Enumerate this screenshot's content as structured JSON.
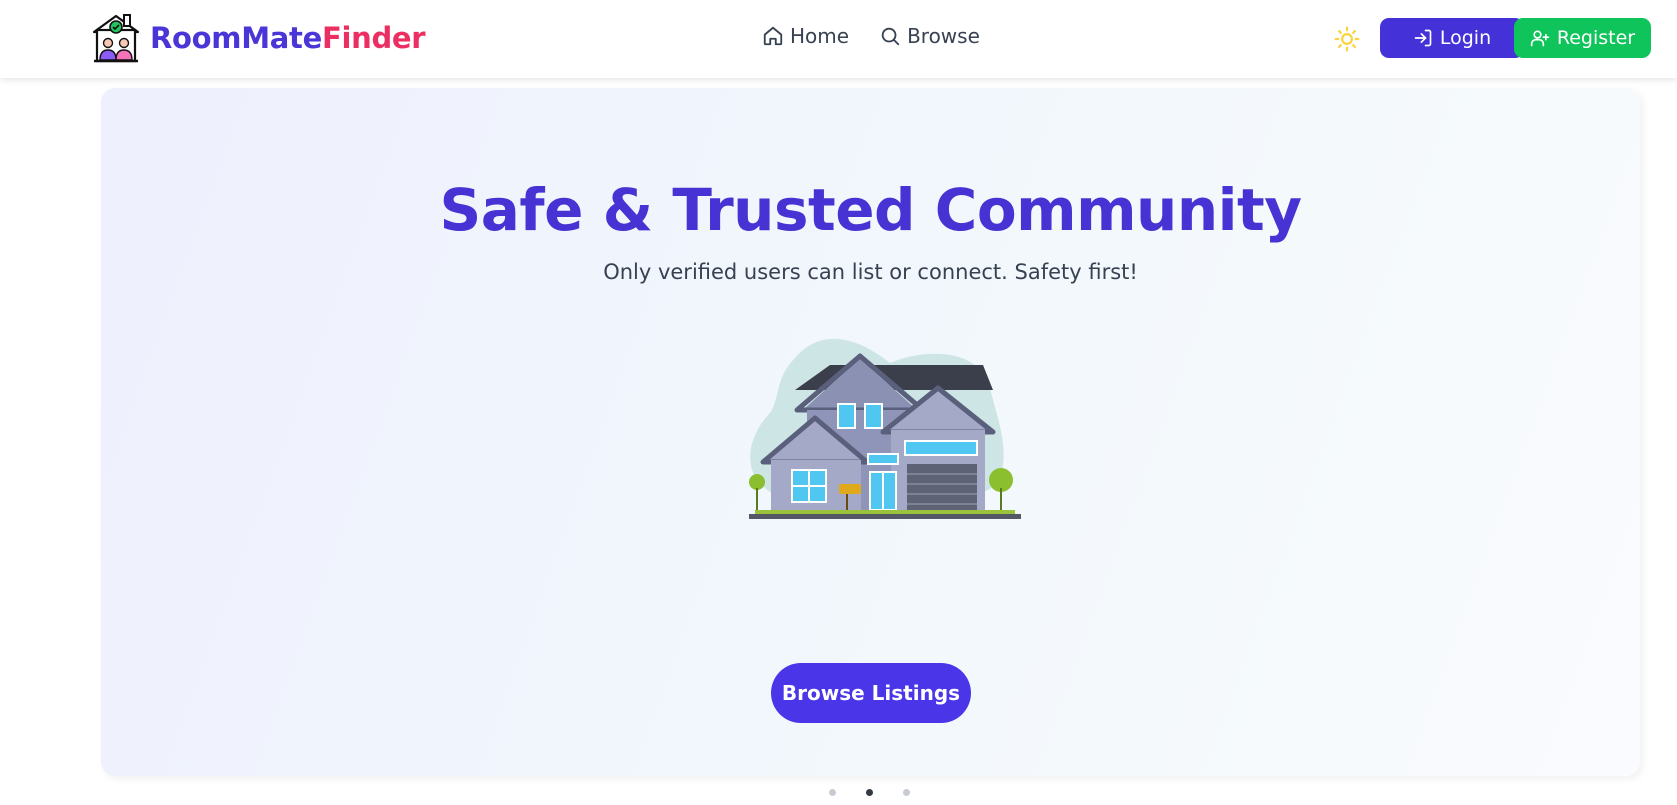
{
  "brand": {
    "name_part1": "RoomMate",
    "name_part2": "Finder"
  },
  "nav": {
    "home_label": "Home",
    "browse_label": "Browse"
  },
  "theme_toggle": {
    "icon": "sun-icon"
  },
  "auth": {
    "login_label": "Login",
    "register_label": "Register"
  },
  "hero": {
    "title": "Safe & Trusted Community",
    "subtitle": "Only verified users can list or connect. Safety first!",
    "illustration": "house-illustration",
    "cta_label": "Browse Listings"
  },
  "carousel": {
    "slide_count": 3,
    "active_index": 2
  },
  "colors": {
    "brand_primary": "#4a35d6",
    "brand_accent": "#ec2f62",
    "register_green": "#0fc45a",
    "cta_purple": "#4a35e8"
  }
}
